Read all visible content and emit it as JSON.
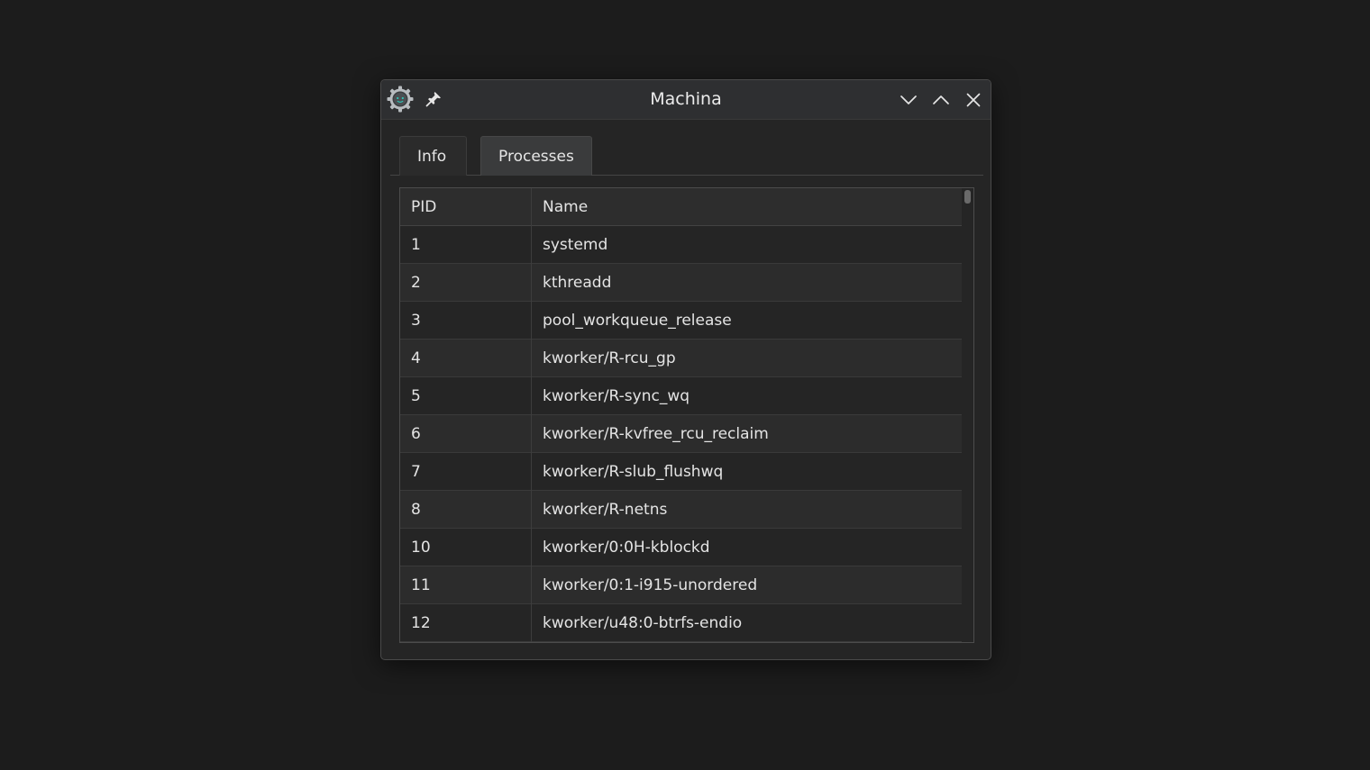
{
  "window": {
    "title": "Machina"
  },
  "icons": {
    "app": "gear-face-icon",
    "pin": "pin-icon",
    "minimize": "chevron-down-icon",
    "maximize": "chevron-up-icon",
    "close": "close-icon"
  },
  "tabs": [
    {
      "label": "Info",
      "active": false
    },
    {
      "label": "Processes",
      "active": true
    }
  ],
  "table": {
    "columns": [
      "PID",
      "Name"
    ],
    "rows": [
      {
        "pid": "1",
        "name": "systemd"
      },
      {
        "pid": "2",
        "name": "kthreadd"
      },
      {
        "pid": "3",
        "name": "pool_workqueue_release"
      },
      {
        "pid": "4",
        "name": "kworker/R-rcu_gp"
      },
      {
        "pid": "5",
        "name": "kworker/R-sync_wq"
      },
      {
        "pid": "6",
        "name": "kworker/R-kvfree_rcu_reclaim"
      },
      {
        "pid": "7",
        "name": "kworker/R-slub_flushwq"
      },
      {
        "pid": "8",
        "name": "kworker/R-netns"
      },
      {
        "pid": "10",
        "name": "kworker/0:0H-kblockd"
      },
      {
        "pid": "11",
        "name": "kworker/0:1-i915-unordered"
      },
      {
        "pid": "12",
        "name": "kworker/u48:0-btrfs-endio"
      }
    ]
  },
  "colors": {
    "accent": "#2ec4b6",
    "background": "#1c1c1c",
    "window": "#252525"
  }
}
